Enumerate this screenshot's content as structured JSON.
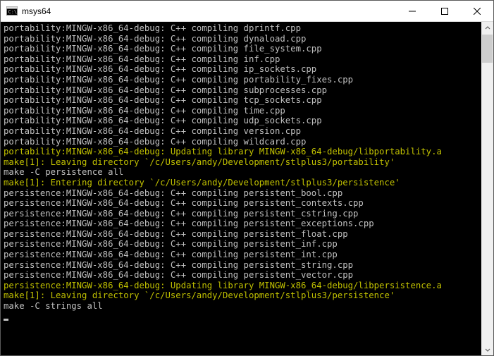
{
  "window": {
    "title": "msys64"
  },
  "terminal": {
    "lines": [
      {
        "c": "normal",
        "t": "portability:MINGW-x86_64-debug: C++ compiling dprintf.cpp"
      },
      {
        "c": "normal",
        "t": "portability:MINGW-x86_64-debug: C++ compiling dynaload.cpp"
      },
      {
        "c": "normal",
        "t": "portability:MINGW-x86_64-debug: C++ compiling file_system.cpp"
      },
      {
        "c": "normal",
        "t": "portability:MINGW-x86_64-debug: C++ compiling inf.cpp"
      },
      {
        "c": "normal",
        "t": "portability:MINGW-x86_64-debug: C++ compiling ip_sockets.cpp"
      },
      {
        "c": "normal",
        "t": "portability:MINGW-x86_64-debug: C++ compiling portability_fixes.cpp"
      },
      {
        "c": "normal",
        "t": "portability:MINGW-x86_64-debug: C++ compiling subprocesses.cpp"
      },
      {
        "c": "normal",
        "t": "portability:MINGW-x86_64-debug: C++ compiling tcp_sockets.cpp"
      },
      {
        "c": "normal",
        "t": "portability:MINGW-x86_64-debug: C++ compiling time.cpp"
      },
      {
        "c": "normal",
        "t": "portability:MINGW-x86_64-debug: C++ compiling udp_sockets.cpp"
      },
      {
        "c": "normal",
        "t": "portability:MINGW-x86_64-debug: C++ compiling version.cpp"
      },
      {
        "c": "normal",
        "t": "portability:MINGW-x86_64-debug: C++ compiling wildcard.cpp"
      },
      {
        "c": "yellow",
        "t": "portability:MINGW-x86_64-debug: Updating library MINGW-x86_64-debug/libportability.a"
      },
      {
        "c": "yellow",
        "t": "make[1]: Leaving directory `/c/Users/andy/Development/stlplus3/portability'"
      },
      {
        "c": "normal",
        "t": "make -C persistence all"
      },
      {
        "c": "yellow",
        "t": "make[1]: Entering directory `/c/Users/andy/Development/stlplus3/persistence'"
      },
      {
        "c": "normal",
        "t": "persistence:MINGW-x86_64-debug: C++ compiling persistent_bool.cpp"
      },
      {
        "c": "normal",
        "t": "persistence:MINGW-x86_64-debug: C++ compiling persistent_contexts.cpp"
      },
      {
        "c": "normal",
        "t": "persistence:MINGW-x86_64-debug: C++ compiling persistent_cstring.cpp"
      },
      {
        "c": "normal",
        "t": "persistence:MINGW-x86_64-debug: C++ compiling persistent_exceptions.cpp"
      },
      {
        "c": "normal",
        "t": "persistence:MINGW-x86_64-debug: C++ compiling persistent_float.cpp"
      },
      {
        "c": "normal",
        "t": "persistence:MINGW-x86_64-debug: C++ compiling persistent_inf.cpp"
      },
      {
        "c": "normal",
        "t": "persistence:MINGW-x86_64-debug: C++ compiling persistent_int.cpp"
      },
      {
        "c": "normal",
        "t": "persistence:MINGW-x86_64-debug: C++ compiling persistent_string.cpp"
      },
      {
        "c": "normal",
        "t": "persistence:MINGW-x86_64-debug: C++ compiling persistent_vector.cpp"
      },
      {
        "c": "yellow",
        "t": "persistence:MINGW-x86_64-debug: Updating library MINGW-x86_64-debug/libpersistence.a"
      },
      {
        "c": "yellow",
        "t": "make[1]: Leaving directory `/c/Users/andy/Development/stlplus3/persistence'"
      },
      {
        "c": "normal",
        "t": "make -C strings all"
      }
    ]
  }
}
